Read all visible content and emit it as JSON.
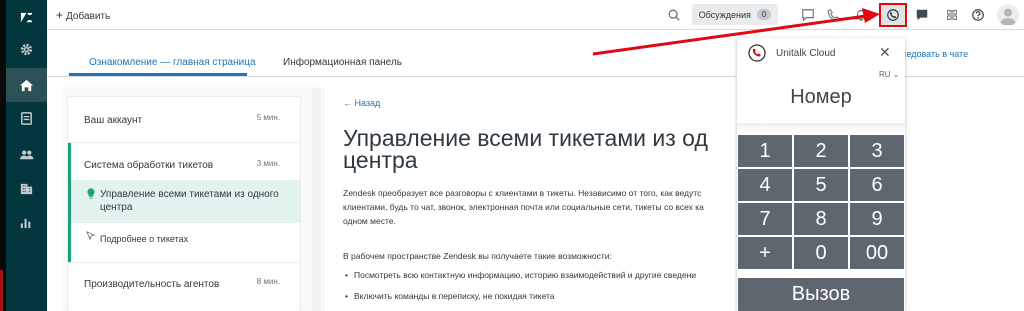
{
  "topbar": {
    "add_label": "Добавить",
    "discussions_label": "Обсуждения",
    "discussions_count": "0"
  },
  "tabs": [
    {
      "label": "Ознакомление — главная страница"
    },
    {
      "label": "Информационная панель"
    }
  ],
  "chat_link": "Беседовать в чате",
  "guide": {
    "items": [
      {
        "title": "Ваш аккаунт",
        "time": "5 мин."
      },
      {
        "title": "Система обработки тикетов",
        "time": "3 мин."
      },
      {
        "title": "Производительность агентов",
        "time": "8 мин."
      }
    ],
    "selected_sub": "Управление всеми тикетами из одного центра",
    "sub_item": "Подробнее о тикетах"
  },
  "article": {
    "back": "Назад",
    "title_line1": "Управление всеми тикетами из од",
    "title_line2": "центра",
    "p1_line1": "Zendesk преобразует все разговоры с клиентами в тикеты. Независимо от того, как ведутс",
    "p1_line2": "клиентами, будь то чат, звонок, электронная почта или социальные сети, тикеты со всех ка",
    "p1_line3": "одном месте.",
    "p2": "В рабочем пространстве Zendesk вы получаете такие возможности:",
    "bullets": [
      "Посмотреть всю контактную информацию, историю взаимодействий и другие сведени",
      "Включить команды в переписку, не покидая тикета"
    ]
  },
  "widget": {
    "title": "Unitalk Cloud",
    "lang": "RU ⌄",
    "number_placeholder": "Номер",
    "keys": [
      "1",
      "2",
      "3",
      "4",
      "5",
      "6",
      "7",
      "8",
      "9",
      "+",
      "0",
      "00"
    ],
    "call_label": "Вызов"
  },
  "colors": {
    "sidebar": "#03363d",
    "accent": "#1f73b7",
    "highlight": "#e30613",
    "keypad": "#5e6770"
  }
}
